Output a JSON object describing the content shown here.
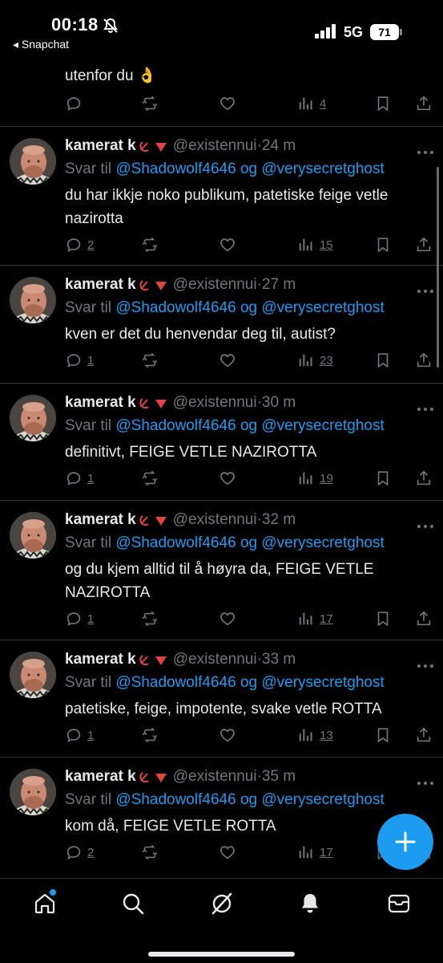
{
  "status_bar": {
    "time": "00:18",
    "back_app": "◂ Snapchat",
    "network": "5G",
    "battery": "71"
  },
  "partial_tweet": {
    "text": "utenfor du 👌",
    "views": "4"
  },
  "tweets": [
    {
      "name": "kamerat k",
      "handle": "@existennui",
      "time": "24 m",
      "reply_prefix": "Svar til",
      "mention1": "@Shadowolf4646",
      "conj": "og",
      "mention2": "@verysecretghost",
      "text": "du har ikkje noko publikum, patetiske feige vetle nazirotta",
      "replies": "2",
      "views": "15"
    },
    {
      "name": "kamerat k",
      "handle": "@existennui",
      "time": "27 m",
      "reply_prefix": "Svar til",
      "mention1": "@Shadowolf4646",
      "conj": "og",
      "mention2": "@verysecretghost",
      "text": "kven er det du henvendar deg til, autist?",
      "replies": "1",
      "views": "23"
    },
    {
      "name": "kamerat k",
      "handle": "@existennui",
      "time": "30 m",
      "reply_prefix": "Svar til",
      "mention1": "@Shadowolf4646",
      "conj": "og",
      "mention2": "@verysecretghost",
      "text": "definitivt, FEIGE VETLE NAZIROTTA",
      "replies": "1",
      "views": "19"
    },
    {
      "name": "kamerat k",
      "handle": "@existennui",
      "time": "32 m",
      "reply_prefix": "Svar til",
      "mention1": "@Shadowolf4646",
      "conj": "og",
      "mention2": "@verysecretghost",
      "text": "og du kjem alltid til å høyra da, FEIGE VETLE NAZIROTTA",
      "replies": "1",
      "views": "17"
    },
    {
      "name": "kamerat k",
      "handle": "@existennui",
      "time": "33 m",
      "reply_prefix": "Svar til",
      "mention1": "@Shadowolf4646",
      "conj": "og",
      "mention2": "@verysecretghost",
      "text": "patetiske, feige, impotente, svake vetle ROTTA",
      "replies": "1",
      "views": "13"
    },
    {
      "name": "kamerat k",
      "handle": "@existennui",
      "time": "35 m",
      "reply_prefix": "Svar til",
      "mention1": "@Shadowolf4646",
      "conj": "og",
      "mention2": "@verysecretghost",
      "text": "kom då, FEIGE VETLE ROTTA",
      "replies": "2",
      "views": "17"
    }
  ],
  "icons": {
    "flags": [
      "hammer-sickle-icon",
      "red-triangle-icon"
    ],
    "actions": [
      "reply-icon",
      "retweet-icon",
      "like-icon",
      "views-icon",
      "bookmark-icon",
      "share-icon"
    ],
    "tabs": [
      "home-icon",
      "search-icon",
      "grok-icon",
      "notifications-icon",
      "messages-icon"
    ]
  },
  "colors": {
    "accent": "#1d9bf0",
    "muted": "#71767b",
    "text": "#e7e9ea",
    "background": "#000000"
  }
}
